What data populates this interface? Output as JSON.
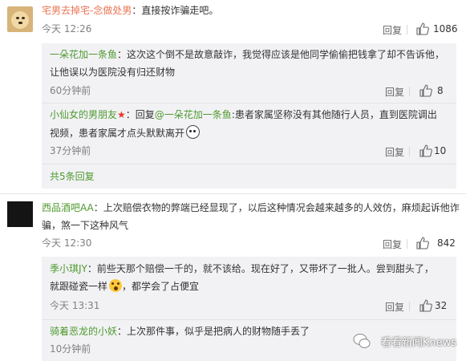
{
  "comments": [
    {
      "user": "宅男去掉宅-念做处男",
      "sep": "：",
      "text": "直接按诈骗走吧。",
      "time": "今天 12:26",
      "reply_label": "回复",
      "likes": "1086",
      "replies": [
        {
          "user": "一朵花加一条鱼",
          "sep": "：",
          "text1": "这次这个倒不是故意敲诈，我觉得应该是他同学偷偷把钱拿了却不告诉他，",
          "text2": "让他误以为医院没有归还财物",
          "time": "60分钟前",
          "reply_label": "回复",
          "likes": "8"
        },
        {
          "user": "小仙女的男朋友",
          "badge": "★",
          "prefix": "：回复",
          "mention": "@一朵花加一条鱼",
          "text1": ":患者家属坚称没有其他随行人员，直到医院调出",
          "text2": "视频，患者家属才点头默默离开",
          "emoji": "sad-emoji",
          "time": "37分钟前",
          "reply_label": "回复",
          "likes": "10"
        }
      ],
      "more": "共5条回复"
    },
    {
      "user": "西品酒吧AA",
      "sep": "：",
      "text1": "上次赔偿衣物的弊端已经显现了，以后这种情况会越来越多的人效仿，麻烦起诉他诈",
      "text2": "骗，煞一下这种风气",
      "time": "今天 12:30",
      "reply_label": "回复",
      "likes": "842",
      "replies": [
        {
          "user": "季小琪JY",
          "sep": "：",
          "text1": "前些天那个赔偿一千的，就不该给。现在好了，又带坏了一批人。尝到甜头了，",
          "text2a": "就跟碰瓷一样",
          "emoji": "shock-emoji",
          "text2b": "，都学会了占便宜",
          "time": "今天 13:31",
          "reply_label": "回复",
          "likes": "32"
        },
        {
          "user": "骑着恶龙的小妖",
          "sep": "：",
          "text1": "上次那件事，似乎是把病人的财物随手丢了",
          "time": "10分钟前"
        }
      ]
    }
  ],
  "watermark": "看看新闻Knews",
  "colors": {
    "username": "#eb7350",
    "green": "#4f9a2f",
    "sub_bg": "#f2f2f5"
  }
}
